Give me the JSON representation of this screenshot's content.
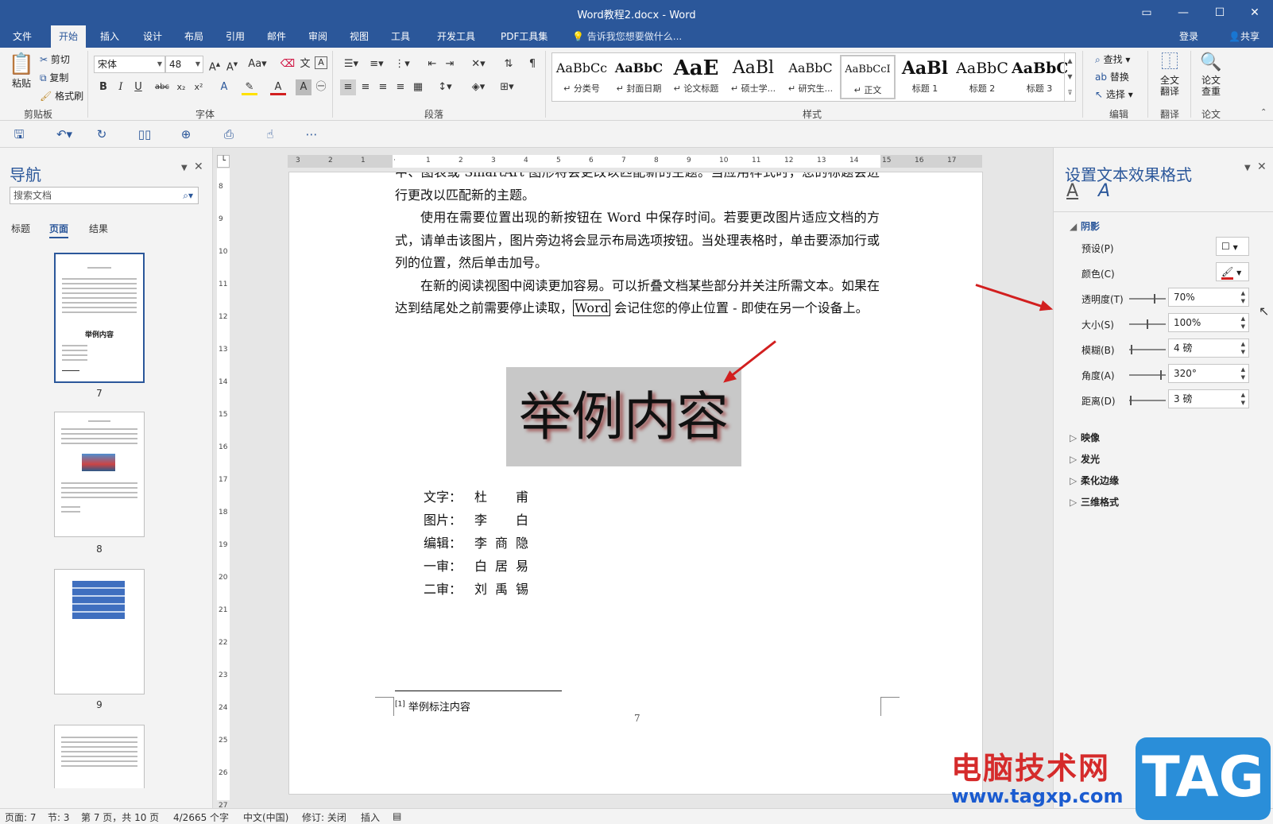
{
  "window": {
    "title": "Word教程2.docx - Word"
  },
  "menu": {
    "tabs": [
      "文件",
      "开始",
      "插入",
      "设计",
      "布局",
      "引用",
      "邮件",
      "审阅",
      "视图",
      "工具",
      "开发工具",
      "PDF工具集"
    ],
    "active": "开始",
    "tell_me": "告诉我您想要做什么...",
    "login": "登录",
    "share": "共享"
  },
  "ribbon": {
    "clipboard": {
      "paste": "粘贴",
      "cut": "剪切",
      "copy": "复制",
      "format_painter": "格式刷",
      "label": "剪贴板"
    },
    "font": {
      "name": "宋体",
      "size": "48",
      "label": "字体"
    },
    "paragraph": {
      "label": "段落"
    },
    "styles": {
      "label": "样式",
      "items": [
        {
          "preview": "AaBbCc",
          "name": "↵ 分类号"
        },
        {
          "preview": "AaBbC",
          "name": "↵ 封面日期"
        },
        {
          "preview": "AaE",
          "name": "↵ 论文标题"
        },
        {
          "preview": "AaBl",
          "name": "↵ 硕士学..."
        },
        {
          "preview": "AaBbC",
          "name": "↵ 研究生..."
        },
        {
          "preview": "AaBbCcI",
          "name": "↵ 正文"
        },
        {
          "preview": "AaBl",
          "name": "标题 1"
        },
        {
          "preview": "AaBbC",
          "name": "标题 2"
        },
        {
          "preview": "AaBbC",
          "name": "标题 3"
        }
      ]
    },
    "editing": {
      "find": "查找",
      "replace": "替换",
      "select": "选择",
      "label": "编辑"
    },
    "translate": {
      "full": "全文\n翻译",
      "label": "翻译"
    },
    "paper": {
      "check": "论文\n查重",
      "label": "论文"
    }
  },
  "nav": {
    "title": "导航",
    "search_placeholder": "搜索文档",
    "tabs": [
      "标题",
      "页面",
      "结果"
    ],
    "active_tab": "页面",
    "pages": [
      "7",
      "8",
      "9"
    ]
  },
  "ruler": {
    "top": [
      "3",
      "2",
      "1",
      "",
      "1",
      "2",
      "3",
      "4",
      "5",
      "6",
      "7",
      "8",
      "9",
      "10",
      "11",
      "12",
      "13",
      "14",
      "15",
      "16",
      "17"
    ],
    "left": [
      "8",
      "9",
      "10",
      "11",
      "12",
      "13",
      "14",
      "15",
      "16",
      "17",
      "18",
      "19",
      "20",
      "21",
      "22",
      "23",
      "24",
      "25",
      "26",
      "27"
    ]
  },
  "document": {
    "para0": "中、图表或 SmartArt 图形将会更改以匹配新的主题。当应用样式时，您的标题会进行更改以匹配新的主题。",
    "para1": "使用在需要位置出现的新按钮在 Word 中保存时间。若要更改图片适应文档的方式，请单击该图片，图片旁边将会显示布局选项按钮。当处理表格时，单击要添加行或列的位置，然后单击加号。",
    "para2_a": "在新的阅读视图中阅读更加容易。可以折叠文档某些部分并关注所需文本。如果在达到结尾处之前需要停止读取，",
    "para2_word": "Word",
    "para2_b": " 会记住您的停止位置 - 即使在另一个设备上。",
    "big_text": "举例内容",
    "credits": [
      {
        "label": "文字：",
        "value": "杜　甫"
      },
      {
        "label": "图片：",
        "value": "李　白"
      },
      {
        "label": "编辑：",
        "value": "李商隐"
      },
      {
        "label": "一审：",
        "value": "白居易"
      },
      {
        "label": "二审：",
        "value": "刘禹锡"
      }
    ],
    "footnote_mark": "[1]",
    "footnote": "举例标注内容",
    "page_number": "7"
  },
  "pane": {
    "title": "设置文本效果格式",
    "sections": {
      "shadow": "阴影",
      "reflection": "映像",
      "glow": "发光",
      "soft_edges": "柔化边缘",
      "three_d": "三维格式"
    },
    "props": [
      {
        "label": "透明度(T)",
        "value": "70%",
        "level": 0.7
      },
      {
        "label": "大小(S)",
        "value": "100%",
        "level": 0.5
      },
      {
        "label": "模糊(B)",
        "value": "4 磅",
        "level": 0.04
      },
      {
        "label": "角度(A)",
        "value": "320°",
        "level": 0.89
      },
      {
        "label": "距离(D)",
        "value": "3 磅",
        "level": 0.03
      }
    ],
    "preset_label": "预设(P)",
    "color_label": "颜色(C)",
    "shadow_color": "#d21f1f"
  },
  "status": {
    "page": "页面: 7",
    "section": "节: 3",
    "page_of": "第 7 页，共 10 页",
    "words": "4/2665 个字",
    "language": "中文(中国)",
    "track": "修订: 关闭",
    "insert": "插入"
  },
  "watermark": {
    "cn": "电脑技术网",
    "url": "www.tagxp.com",
    "tag": "TAG"
  }
}
